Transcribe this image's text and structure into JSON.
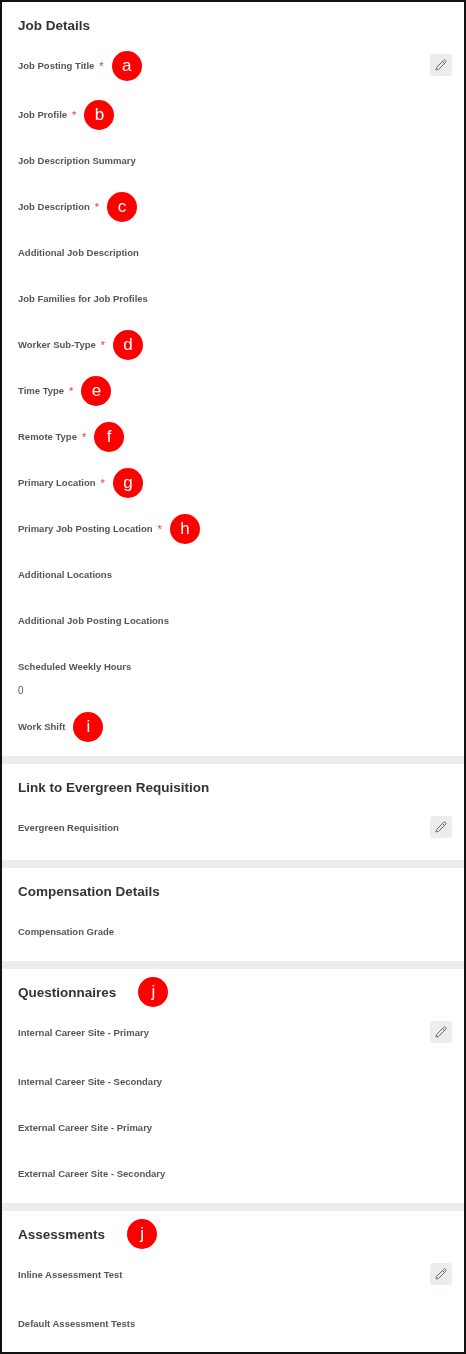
{
  "sections": [
    {
      "title": "Job Details",
      "fields": [
        {
          "label": "Job Posting Title",
          "required_mark": "*",
          "marker": "a",
          "editable": true
        },
        {
          "label": "Job Profile",
          "required_mark": "*",
          "marker": "b",
          "editable": false
        },
        {
          "label": "Job Description Summary",
          "editable": false
        },
        {
          "label": "Job Description",
          "required_mark": "*",
          "marker": "c",
          "editable": false
        },
        {
          "label": "Additional Job Description",
          "editable": false
        },
        {
          "label": "Job Families for Job Profiles",
          "editable": false
        },
        {
          "label": "Worker Sub-Type",
          "required_mark": "*",
          "marker": "d",
          "editable": false
        },
        {
          "label": "Time Type",
          "required_mark": "*",
          "marker": "e",
          "editable": false
        },
        {
          "label": "Remote Type",
          "required_mark": "*",
          "marker": "f",
          "editable": false
        },
        {
          "label": "Primary Location",
          "required_mark": "*",
          "marker": "g",
          "editable": false
        },
        {
          "label": "Primary Job Posting Location",
          "required_mark": "*",
          "marker": "h",
          "editable": false
        },
        {
          "label": "Additional Locations",
          "editable": false
        },
        {
          "label": "Additional Job Posting Locations",
          "editable": false
        },
        {
          "label": "Scheduled Weekly Hours",
          "value": "0",
          "editable": false
        },
        {
          "label": "Work Shift",
          "marker": "i",
          "editable": false
        }
      ]
    },
    {
      "title": "Link to Evergreen Requisition",
      "fields": [
        {
          "label": "Evergreen Requisition",
          "editable": true
        }
      ]
    },
    {
      "title": "Compensation Details",
      "fields": [
        {
          "label": "Compensation Grade",
          "editable": false
        }
      ]
    },
    {
      "title": "Questionnaires",
      "marker": "j",
      "fields": [
        {
          "label": "Internal Career Site - Primary",
          "editable": true
        },
        {
          "label": "Internal Career Site - Secondary",
          "editable": false
        },
        {
          "label": "External Career Site - Primary",
          "editable": false
        },
        {
          "label": "External Career Site - Secondary",
          "editable": false
        }
      ]
    },
    {
      "title": "Assessments",
      "marker": "j",
      "fields": [
        {
          "label": "Inline Assessment Test",
          "editable": true
        },
        {
          "label": "Default Assessment Tests",
          "editable": false
        }
      ]
    }
  ]
}
